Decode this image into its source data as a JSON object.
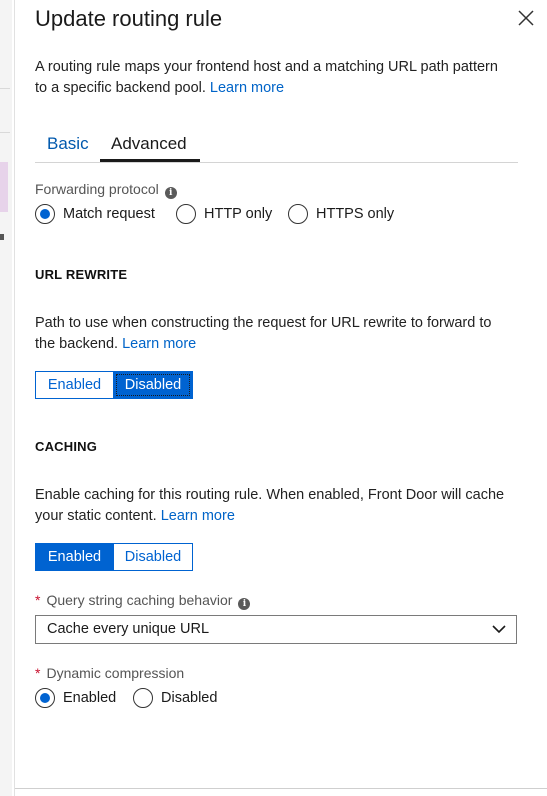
{
  "panel": {
    "title": "Update routing rule",
    "description": "A routing rule maps your frontend host and a matching URL path pattern to a specific backend pool.",
    "learn_more": "Learn more",
    "close_icon": "close-icon"
  },
  "tabs": [
    {
      "label": "Basic",
      "selected": false
    },
    {
      "label": "Advanced",
      "selected": true
    }
  ],
  "forwarding": {
    "label": "Forwarding protocol",
    "options": [
      "Match request",
      "HTTP only",
      "HTTPS only"
    ],
    "selected": "Match request"
  },
  "url_rewrite": {
    "heading": "URL REWRITE",
    "description": "Path to use when constructing the request for URL rewrite to forward to the backend.",
    "learn_more": "Learn more",
    "enabled_label": "Enabled",
    "disabled_label": "Disabled",
    "selected": "Disabled"
  },
  "caching": {
    "heading": "CACHING",
    "description": "Enable caching for this routing rule. When enabled, Front Door will cache your static content.",
    "learn_more": "Learn more",
    "enabled_label": "Enabled",
    "disabled_label": "Disabled",
    "selected": "Enabled"
  },
  "query_string": {
    "label": "Query string caching behavior",
    "value": "Cache every unique URL",
    "required": true
  },
  "dynamic_compression": {
    "label": "Dynamic compression",
    "options": [
      "Enabled",
      "Disabled"
    ],
    "selected": "Enabled",
    "required": true
  },
  "colors": {
    "accent": "#0063d1",
    "link": "#0064c8",
    "required_star": "#c8102e"
  }
}
